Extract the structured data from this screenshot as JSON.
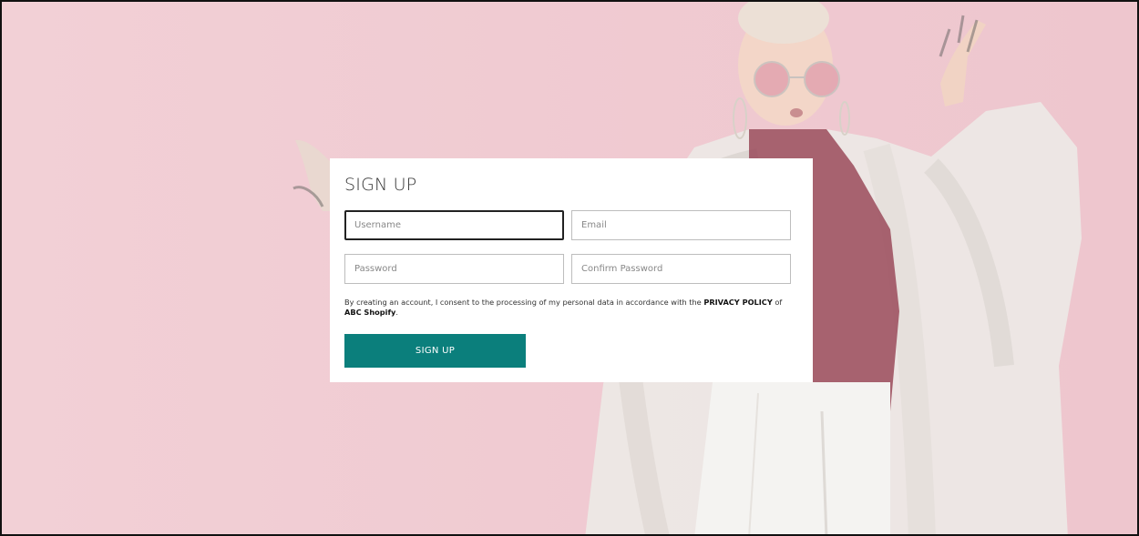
{
  "form": {
    "title": "SIGN UP",
    "username_placeholder": "Username",
    "email_placeholder": "Email",
    "password_placeholder": "Password",
    "confirm_password_placeholder": "Confirm Password",
    "consent_prefix": "By creating an account, I consent to the processing of my personal data in accordance with the ",
    "privacy_policy_link": "PRIVACY POLICY",
    "consent_mid": " of ",
    "brand": "ABC Shopify",
    "consent_suffix": ".",
    "submit_label": "SIGN UP"
  },
  "colors": {
    "background": "#f0cbd2",
    "accent": "#0b7f7c",
    "card": "#ffffff"
  }
}
